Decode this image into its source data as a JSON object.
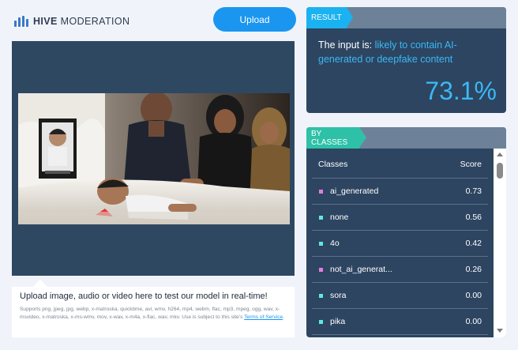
{
  "header": {
    "logo_bold": "HIVE",
    "logo_light": "MODERATION",
    "upload_button": "Upload",
    "accent": "#1a96f0"
  },
  "upload_info": {
    "title": "Upload image, audio or video here to test our model in real-time!",
    "formats": "Supports png, jpeg, jpg, webp, x-matroska, quicktime, avi, wmv, h264, mp4, webm, flac, mp3, mpeg, ogg, wav, x-msvideo, x-matroska, x-ms-wmv, mov, x-wav, x-m4a, x-flac, wav, mkv. Use is subject to this site's",
    "terms_link": "Terms of Service",
    "terms_suffix": "."
  },
  "result": {
    "tab_label": "RESULT",
    "prefix": "The input is: ",
    "verdict": "likely to contain AI-generated or deepfake content",
    "score": "73.1%",
    "tab_color": "#1ab2f0"
  },
  "classes": {
    "tab_label": "BY CLASSES",
    "col_class": "Classes",
    "col_score": "Score",
    "tab_color": "#2ec1a8",
    "rows": [
      {
        "name": "ai_generated",
        "score": "0.73",
        "color": "#e27de0"
      },
      {
        "name": "none",
        "score": "0.56",
        "color": "#5fe8e3"
      },
      {
        "name": "4o",
        "score": "0.42",
        "color": "#5fe8e3"
      },
      {
        "name": "not_ai_generat...",
        "score": "0.26",
        "color": "#e27de0"
      },
      {
        "name": "sora",
        "score": "0.00",
        "color": "#5fe8e3"
      },
      {
        "name": "pika",
        "score": "0.00",
        "color": "#5fe8e3"
      }
    ]
  }
}
